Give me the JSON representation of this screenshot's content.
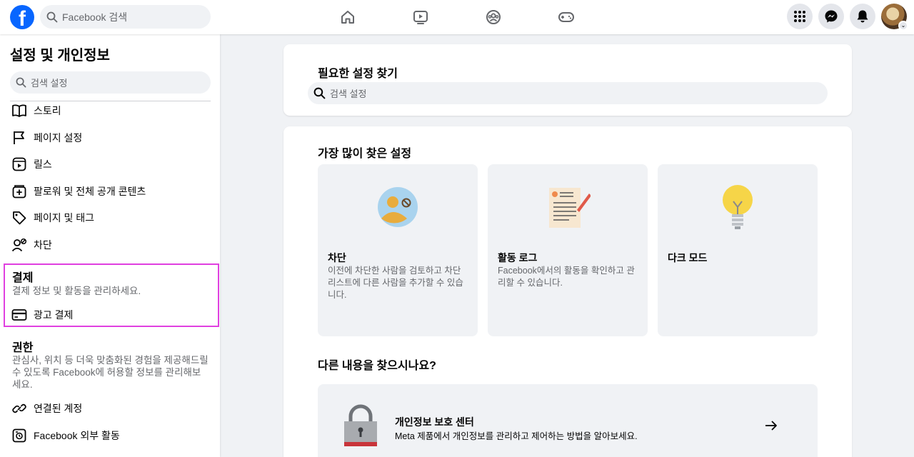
{
  "topbar": {
    "logo_letter": "f",
    "search_placeholder": "Facebook 검색",
    "nav_icons": [
      "home-icon",
      "watch-icon",
      "groups-icon",
      "gaming-icon"
    ],
    "right_icons": [
      "menu-grid-icon",
      "messenger-icon",
      "notifications-icon",
      "profile-avatar"
    ],
    "brand_color": "#0866ff"
  },
  "sidebar": {
    "title": "설정 및 개인정보",
    "search_placeholder": "검색 설정",
    "items_top": [
      {
        "label": "스토리",
        "icon": "book-open-icon"
      },
      {
        "label": "페이지 설정",
        "icon": "flag-icon"
      },
      {
        "label": "릴스",
        "icon": "reels-icon"
      },
      {
        "label": "팔로워 및 전체 공개 콘텐츠",
        "icon": "add-box-icon"
      },
      {
        "label": "페이지 및 태그",
        "icon": "tag-icon"
      },
      {
        "label": "차단",
        "icon": "block-user-icon"
      }
    ],
    "payment": {
      "heading": "결제",
      "desc": "결제 정보 및 활동을 관리하세요.",
      "item": {
        "label": "광고 결제",
        "icon": "credit-card-icon"
      }
    },
    "permissions": {
      "heading": "권한",
      "desc": "관심사, 위치 등 더욱 맞춤화된 경험을 제공해드릴 수 있도록 Facebook에 허용할 정보를 관리해보세요.",
      "items": [
        {
          "label": "연결된 계정",
          "icon": "link-icon"
        },
        {
          "label": "Facebook 외부 활동",
          "icon": "off-facebook-activity-icon"
        }
      ]
    }
  },
  "main": {
    "find": {
      "title": "필요한 설정 찾기",
      "search_placeholder": "검색 설정"
    },
    "popular": {
      "title": "가장 많이 찾은 설정",
      "tiles": [
        {
          "title": "차단",
          "desc": "이전에 차단한 사람을 검토하고 차단 리스트에 다른 사람을 추가할 수 있습니다.",
          "icon": "blocked-person-illustration"
        },
        {
          "title": "활동 로그",
          "desc": "Facebook에서의 활동을 확인하고 관리할 수 있습니다.",
          "icon": "activity-log-illustration"
        },
        {
          "title": "다크 모드",
          "desc": "",
          "icon": "lightbulb-illustration"
        }
      ]
    },
    "more": {
      "title": "다른 내용을 찾으시나요?",
      "privacy_center": {
        "title": "개인정보 보호 센터",
        "desc": "Meta 제품에서 개인정보를 관리하고 제어하는 방법을 알아보세요.",
        "icon": "padlock-illustration"
      }
    }
  }
}
